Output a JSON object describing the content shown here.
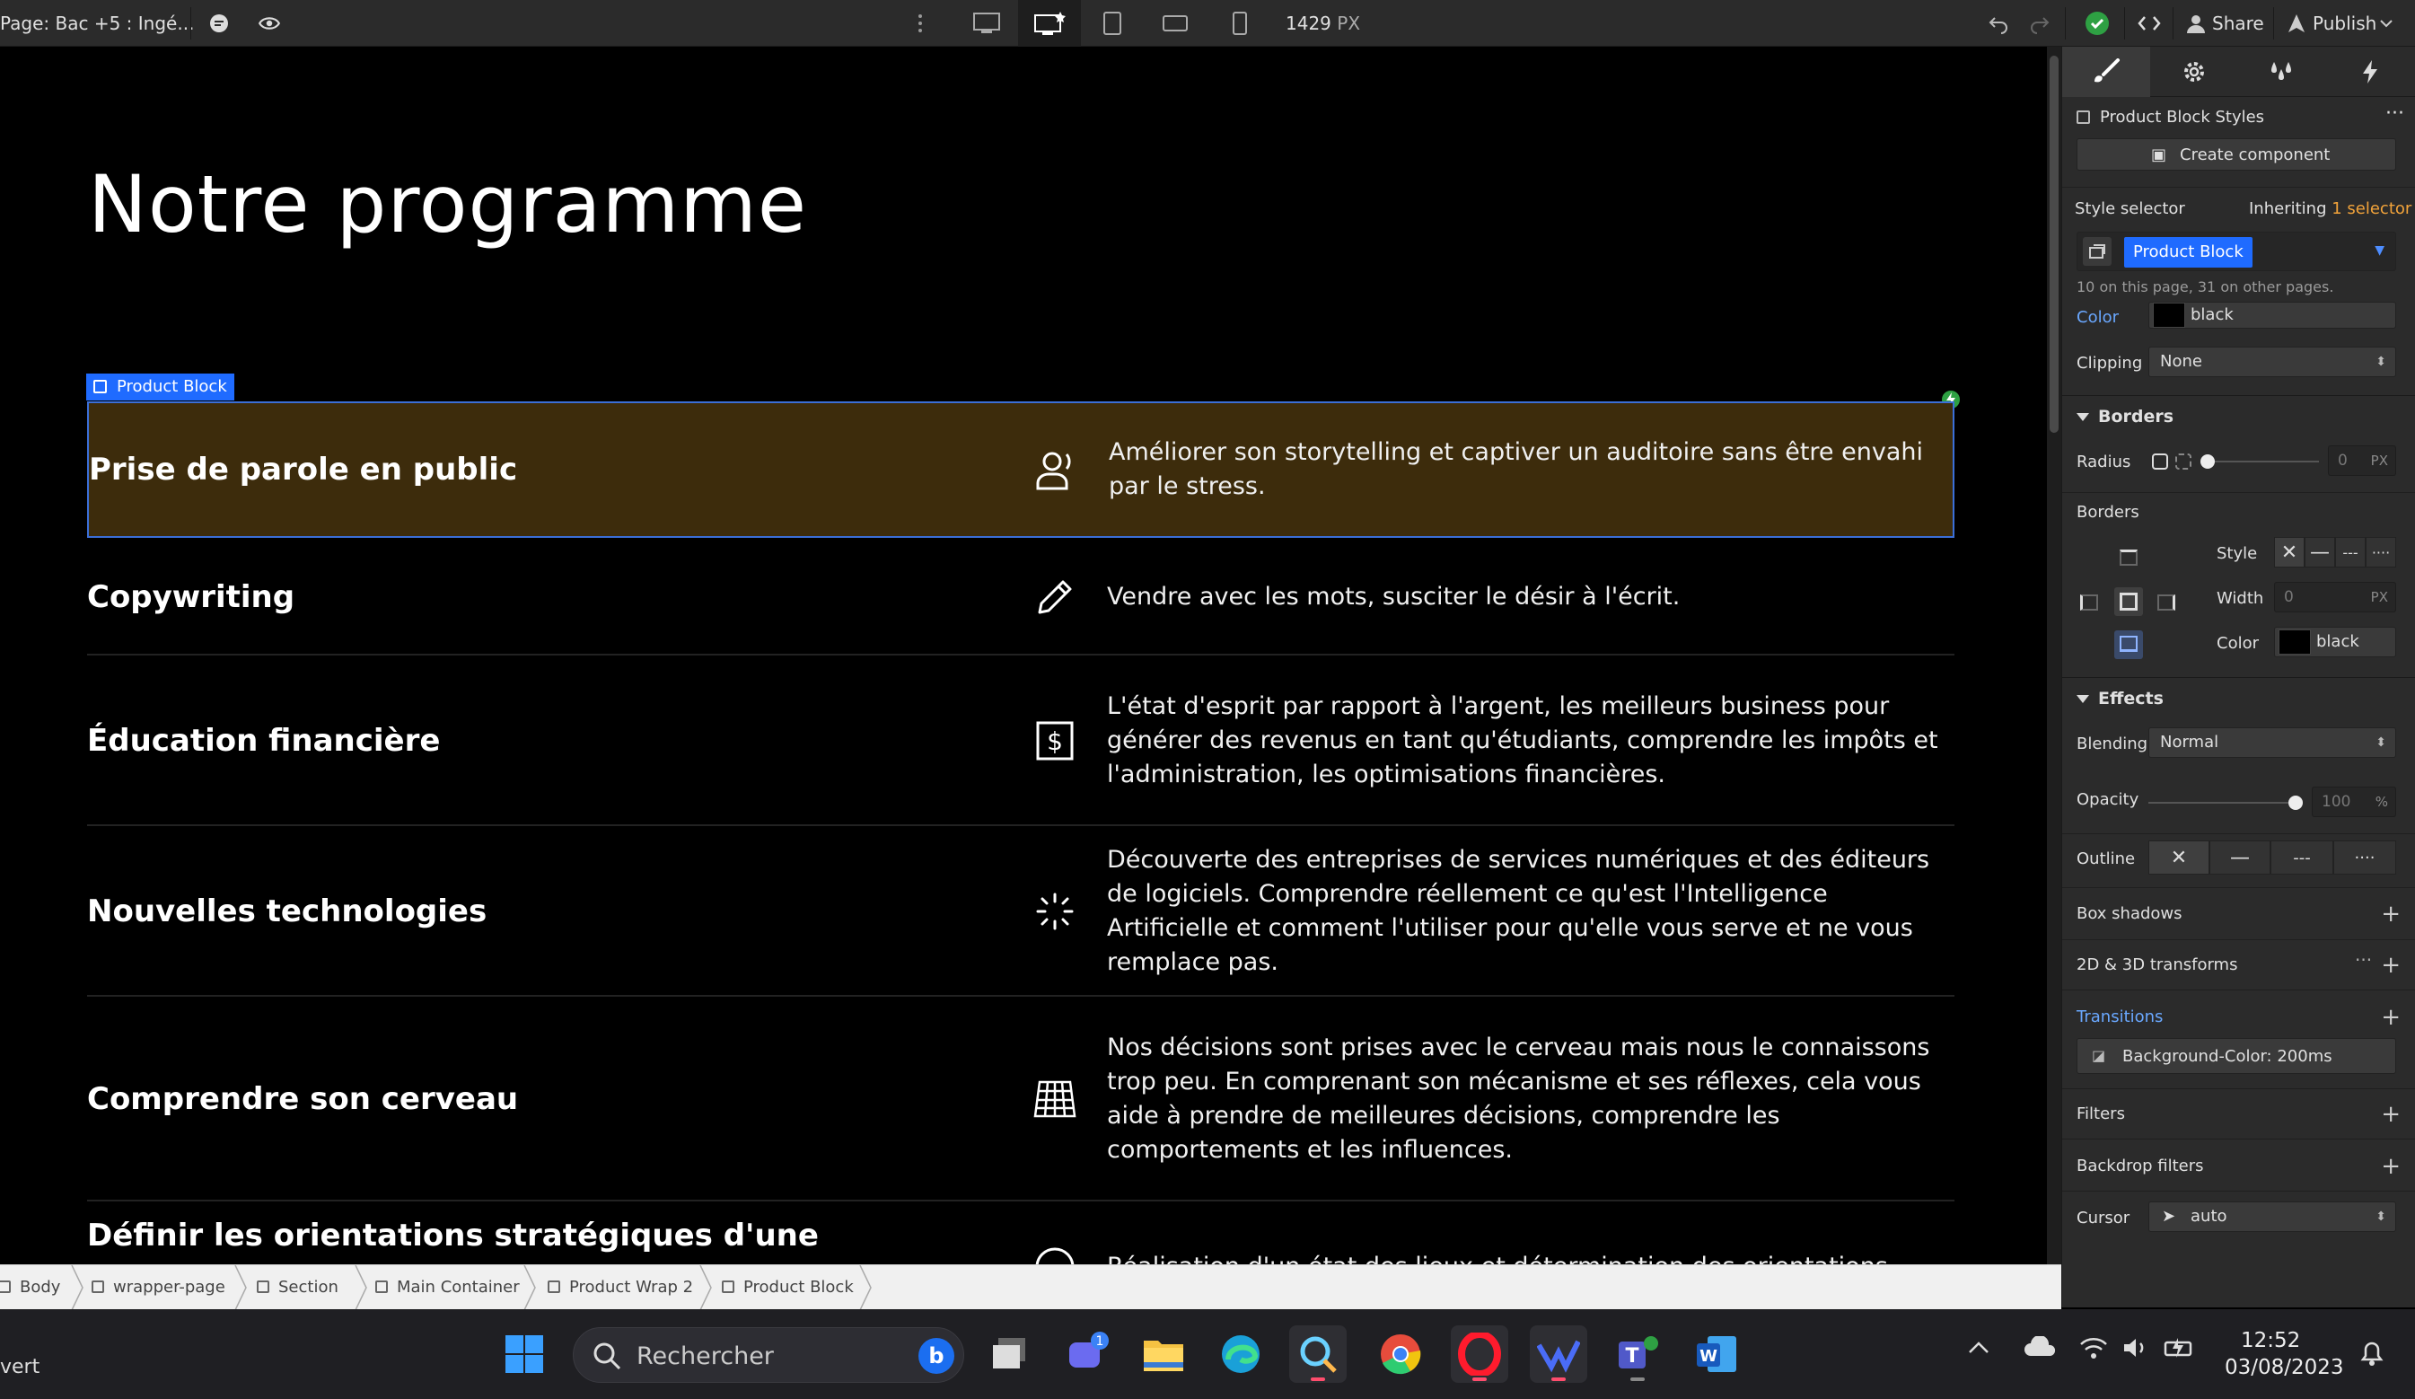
{
  "topbar": {
    "page_label": "Page: Bac +5 : Ingé...",
    "breakpoint_width": "1429",
    "breakpoint_unit": "PX",
    "share_label": "Share",
    "publish_label": "Publish"
  },
  "canvas": {
    "title": "Notre programme",
    "selected_tag": "Product Block",
    "products": [
      {
        "title": "Prise de parole en public",
        "icon": "speaker-person-icon",
        "desc": "Améliorer son storytelling et captiver un auditoire sans être envahi par le stress."
      },
      {
        "title": "Copywriting",
        "icon": "pencil-icon",
        "desc": "Vendre avec les mots, susciter le désir à l'écrit."
      },
      {
        "title": "Éducation financière",
        "icon": "dollar-icon",
        "desc": "L'état d'esprit par rapport à l'argent, les meilleurs business pour générer des revenus en tant qu'étudiants, comprendre les impôts et l'administration, les optimisations financières."
      },
      {
        "title": "Nouvelles technologies",
        "icon": "loader-icon",
        "desc": "Découverte des entreprises de services numériques et des éditeurs de logiciels. Comprendre réellement ce qu'est l'Intelligence Artificielle et comment l'utiliser pour qu'elle vous serve et ne vous remplace pas."
      },
      {
        "title": "Comprendre son cerveau",
        "icon": "grid-icon",
        "desc": "Nos décisions sont prises avec le cerveau mais nous le connaissons trop peu. En comprenant son mécanisme et ses réflexes, cela vous aide à prendre de meilleures décisions, comprendre les comportements et les influences."
      },
      {
        "title": "Définir les orientations stratégiques d'une",
        "icon": "circle-icon",
        "desc": "Réalisation d'un état des lieux et détermination des orientations stratégiques"
      }
    ]
  },
  "breadcrumb": [
    "Body",
    "wrapper-page",
    "Section",
    "Main Container",
    "Product Wrap 2",
    "Product Block"
  ],
  "panel": {
    "block_styles": "Product Block Styles",
    "create_component": "Create component",
    "style_selector_label": "Style selector",
    "inheriting": "Inheriting",
    "inheriting_count": "1 selector",
    "selector_chip": "Product Block",
    "page_count": "10 on this page, 31 on other pages.",
    "color_label": "Color",
    "color_value": "black",
    "clipping_label": "Clipping",
    "clipping_value": "None",
    "borders_head": "Borders",
    "radius_label": "Radius",
    "radius_value": "0",
    "radius_unit": "PX",
    "borders_label": "Borders",
    "style_label": "Style",
    "width_label": "Width",
    "width_value": "0",
    "width_unit": "PX",
    "border_color_label": "Color",
    "border_color_value": "black",
    "effects_head": "Effects",
    "blending_label": "Blending",
    "blending_value": "Normal",
    "opacity_label": "Opacity",
    "opacity_value": "100",
    "opacity_unit": "%",
    "outline_label": "Outline",
    "box_shadows": "Box shadows",
    "transforms": "2D & 3D transforms",
    "transitions": "Transitions",
    "transition_item": "Background-Color: 200ms",
    "filters": "Filters",
    "backdrop_filters": "Backdrop filters",
    "cursor_label": "Cursor",
    "cursor_value": "auto"
  },
  "taskbar": {
    "left_text": "vert",
    "search_placeholder": "Rechercher",
    "teams_badge": "1",
    "time": "12:52",
    "date": "03/08/2023"
  },
  "colors": {
    "accent": "#1f6bff",
    "selected_row_bg": "#3d2c0c",
    "publish_green": "#2ea043",
    "inherit_orange": "#f2a33a"
  }
}
